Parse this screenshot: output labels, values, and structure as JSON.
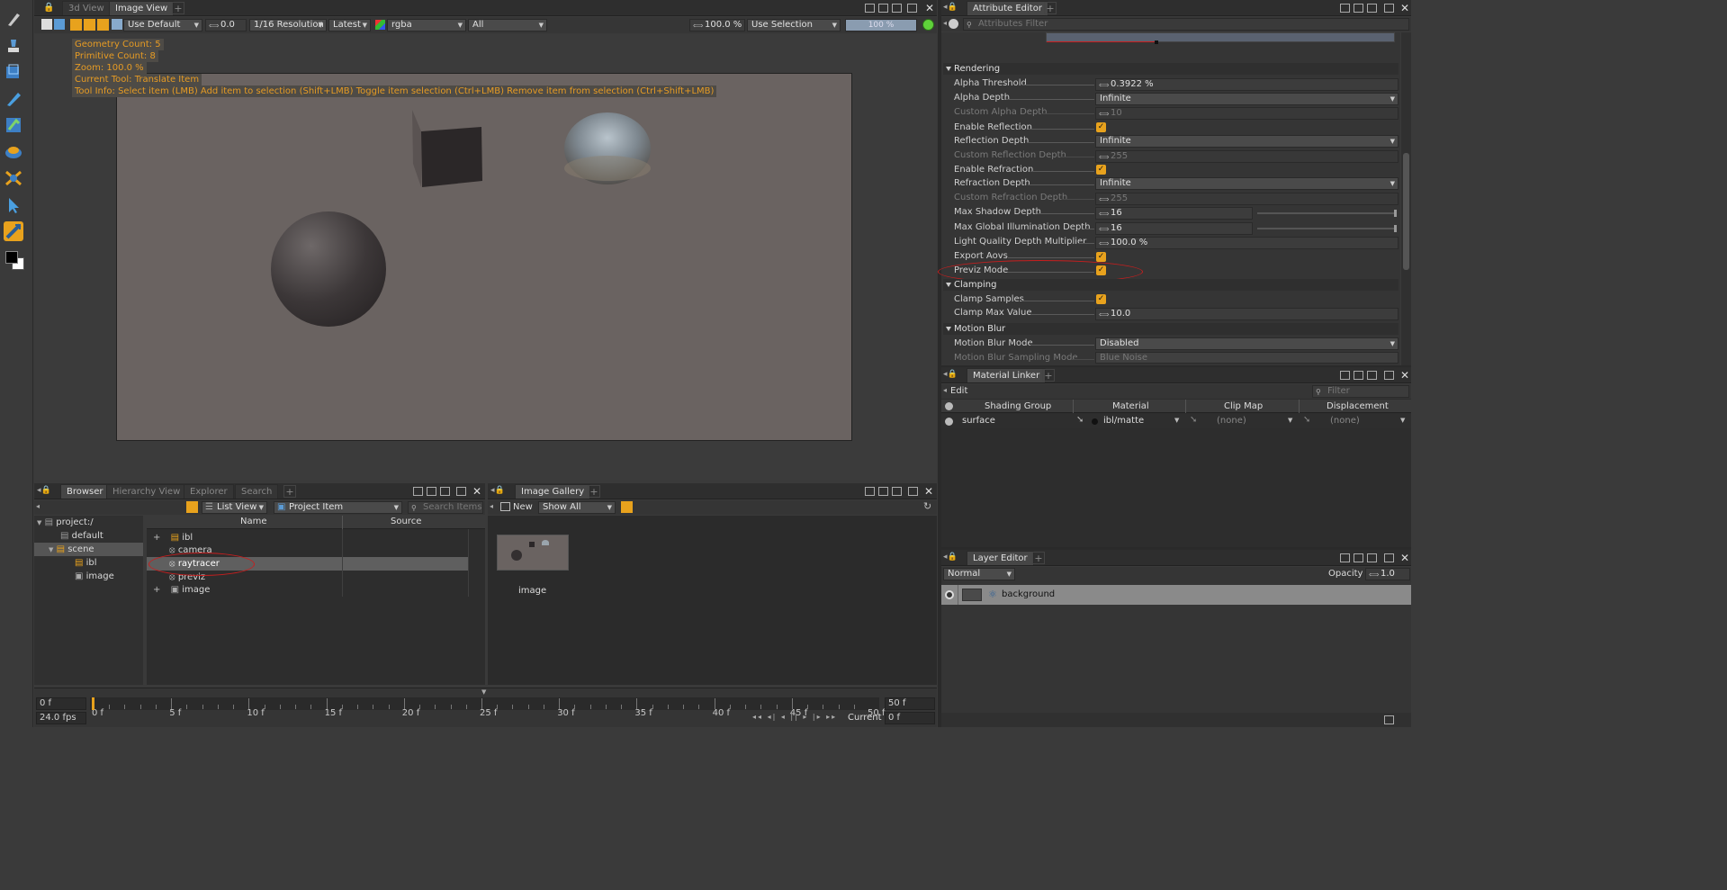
{
  "left_toolbar": {
    "tools": [
      "brush-tool",
      "smudge-tool",
      "transform-tool",
      "picker-tool",
      "paint-tool",
      "light-tool",
      "camera-tool",
      "select-tool",
      "translate-tool",
      "color-swatch"
    ]
  },
  "viewport": {
    "tabs": [
      "3d View",
      "Image View"
    ],
    "toolbar": {
      "display_mode": "Use Default",
      "exposure": "0.0",
      "resolution": "1/16 Resolution",
      "version": "Latest",
      "channels": "rgba",
      "layers": "All",
      "zoom": "100.0 %",
      "selection": "Use Selection",
      "progress_text": "100 %",
      "progress": 1.0
    },
    "hud": [
      "Geometry Count: 5",
      "Primitive Count: 8",
      "Zoom: 100.0 %",
      "Current Tool: Translate Item",
      "Tool Info: Select item (LMB)  Add item to selection (Shift+LMB)  Toggle item selection (Ctrl+LMB)  Remove item from selection (Ctrl+Shift+LMB)"
    ]
  },
  "browser": {
    "tabs": [
      "Browser",
      "Hierarchy View",
      "Explorer",
      "Search"
    ],
    "view_mode": "List View",
    "filter": "Project Item",
    "search_placeholder": "Search Items",
    "tree": [
      "project:/",
      "default",
      "scene",
      "ibl",
      "image"
    ],
    "columns": [
      "Name",
      "Source"
    ],
    "items": [
      "ibl",
      "camera",
      "raytracer",
      "previz",
      "image"
    ]
  },
  "gallery": {
    "tab": "Image Gallery",
    "new_label": "New",
    "filter": "Show All",
    "thumb_label": "image"
  },
  "attribute_editor": {
    "tab": "Attribute Editor",
    "filter_placeholder": "Attributes Filter",
    "sections": {
      "rendering": "Rendering",
      "clamping": "Clamping",
      "motion_blur": "Motion Blur"
    },
    "rows": {
      "alpha_threshold": {
        "label": "Alpha Threshold",
        "value": "0.3922 %"
      },
      "alpha_depth": {
        "label": "Alpha Depth",
        "value": "Infinite"
      },
      "custom_alpha_depth": {
        "label": "Custom Alpha Depth",
        "value": "10"
      },
      "enable_reflection": {
        "label": "Enable Reflection"
      },
      "reflection_depth": {
        "label": "Reflection Depth",
        "value": "Infinite"
      },
      "custom_reflection_depth": {
        "label": "Custom Reflection Depth",
        "value": "255"
      },
      "enable_refraction": {
        "label": "Enable Refraction"
      },
      "refraction_depth": {
        "label": "Refraction Depth",
        "value": "Infinite"
      },
      "custom_refraction_depth": {
        "label": "Custom Refraction Depth",
        "value": "255"
      },
      "max_shadow_depth": {
        "label": "Max Shadow Depth",
        "value": "16"
      },
      "max_gi_depth": {
        "label": "Max Global Illumination Depth",
        "value": "16"
      },
      "light_quality": {
        "label": "Light Quality Depth Multiplier",
        "value": "100.0 %"
      },
      "export_aovs": {
        "label": "Export Aovs"
      },
      "previz_mode": {
        "label": "Previz Mode"
      },
      "clamp_samples": {
        "label": "Clamp Samples"
      },
      "clamp_max_value": {
        "label": "Clamp Max Value",
        "value": "10.0"
      },
      "motion_blur_mode": {
        "label": "Motion Blur Mode",
        "value": "Disabled"
      },
      "motion_blur_sampling": {
        "label": "Motion Blur Sampling Mode",
        "value": "Blue Noise"
      }
    }
  },
  "material_linker": {
    "tab": "Material Linker",
    "edit": "Edit",
    "filter_placeholder": "Filter",
    "columns": [
      "Shading Group",
      "Material",
      "Clip Map",
      "Displacement"
    ],
    "row": {
      "group": "surface",
      "material": "ibl/matte",
      "clip": "(none)",
      "disp": "(none)"
    }
  },
  "layer_editor": {
    "tab": "Layer Editor",
    "blend": "Normal",
    "opacity_label": "Opacity",
    "opacity": "1.0",
    "layer": "background"
  },
  "timeline": {
    "start": "0 f",
    "end": "50 f",
    "ticks": [
      "0 f",
      "5 f",
      "10 f",
      "15 f",
      "20 f",
      "25 f",
      "30 f",
      "35 f",
      "40 f",
      "45 f",
      "50 f"
    ],
    "fps": "24.0 fps",
    "current_label": "Current",
    "current": "0 f"
  },
  "colors": {
    "accent": "#e8a21d",
    "annotation": "#c81e1e",
    "hud_text": "#e69b24"
  }
}
